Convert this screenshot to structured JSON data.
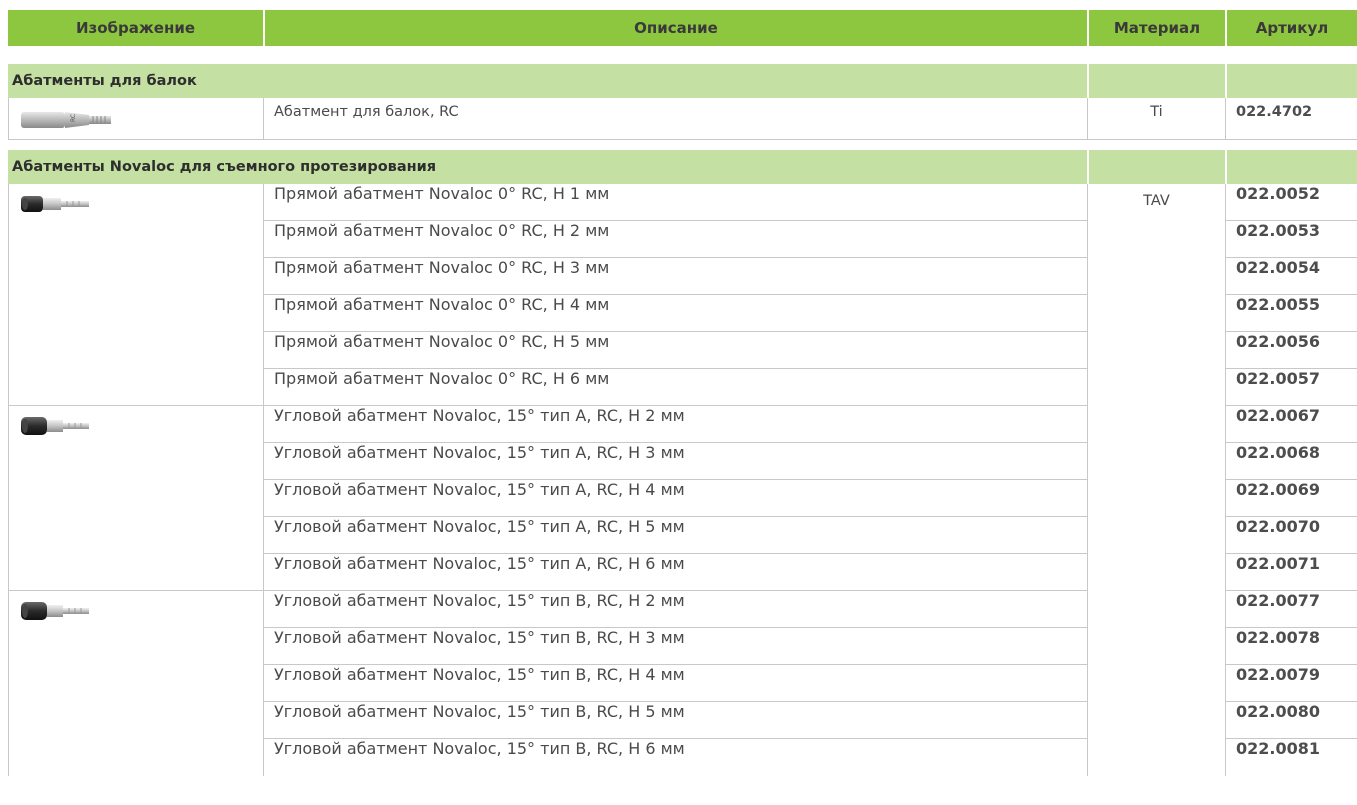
{
  "header": {
    "image": "Изображение",
    "description": "Описание",
    "material": "Материал",
    "article": "Артикул"
  },
  "sections": [
    {
      "title": "Абатменты для балок",
      "rows": [
        {
          "description": "Абатмент для балок, RC",
          "material": "Ti",
          "article": "022.4702",
          "image": "bar-abutment-icon",
          "image_label": "RC"
        }
      ]
    },
    {
      "title": "Абатменты Novaloc для съемного протезирования",
      "material": "TAV",
      "rows": [
        {
          "description": "Прямой абатмент Novaloc 0° RC, H 1 мм",
          "article": "022.0052"
        },
        {
          "description": "Прямой абатмент Novaloc 0° RC, H 2 мм",
          "article": "022.0053"
        },
        {
          "description": "Прямой абатмент Novaloc 0° RC, H 3 мм",
          "article": "022.0054"
        },
        {
          "description": "Прямой абатмент Novaloc 0° RC, H 4 мм",
          "article": "022.0055"
        },
        {
          "description": "Прямой абатмент Novaloc 0° RC, H 5 мм",
          "article": "022.0056"
        },
        {
          "description": "Прямой абатмент Novaloc 0° RC, H 6 мм",
          "article": "022.0057"
        },
        {
          "description": "Угловой абатмент Novaloc, 15° тип A, RC, H 2 мм",
          "article": "022.0067"
        },
        {
          "description": "Угловой абатмент Novaloc, 15° тип A, RC, H 3 мм",
          "article": "022.0068"
        },
        {
          "description": "Угловой абатмент Novaloc, 15° тип A, RC, H 4 мм",
          "article": "022.0069"
        },
        {
          "description": "Угловой абатмент Novaloc, 15° тип A, RC, H 5 мм",
          "article": "022.0070"
        },
        {
          "description": "Угловой абатмент Novaloc, 15° тип A, RC, H 6 мм",
          "article": "022.0071"
        },
        {
          "description": "Угловой абатмент Novaloc, 15° тип B, RC, H 2 мм",
          "article": "022.0077"
        },
        {
          "description": "Угловой абатмент Novaloc, 15° тип B, RC, H 3 мм",
          "article": "022.0078"
        },
        {
          "description": "Угловой абатмент Novaloc, 15° тип B, RC, H 4 мм",
          "article": "022.0079"
        },
        {
          "description": "Угловой абатмент Novaloc, 15° тип B, RC, H 5 мм",
          "article": "022.0080"
        },
        {
          "description": "Угловой абатмент Novaloc, 15° тип B, RC, H 6 мм",
          "article": "022.0081"
        }
      ],
      "images": [
        "novaloc-straight-abutment-icon",
        "novaloc-angled-type-a-abutment-icon",
        "novaloc-angled-type-b-abutment-icon"
      ]
    }
  ],
  "colors": {
    "header_green": "#8dc63f",
    "section_green": "#c5e0a3",
    "border": "#c8c8c8"
  }
}
